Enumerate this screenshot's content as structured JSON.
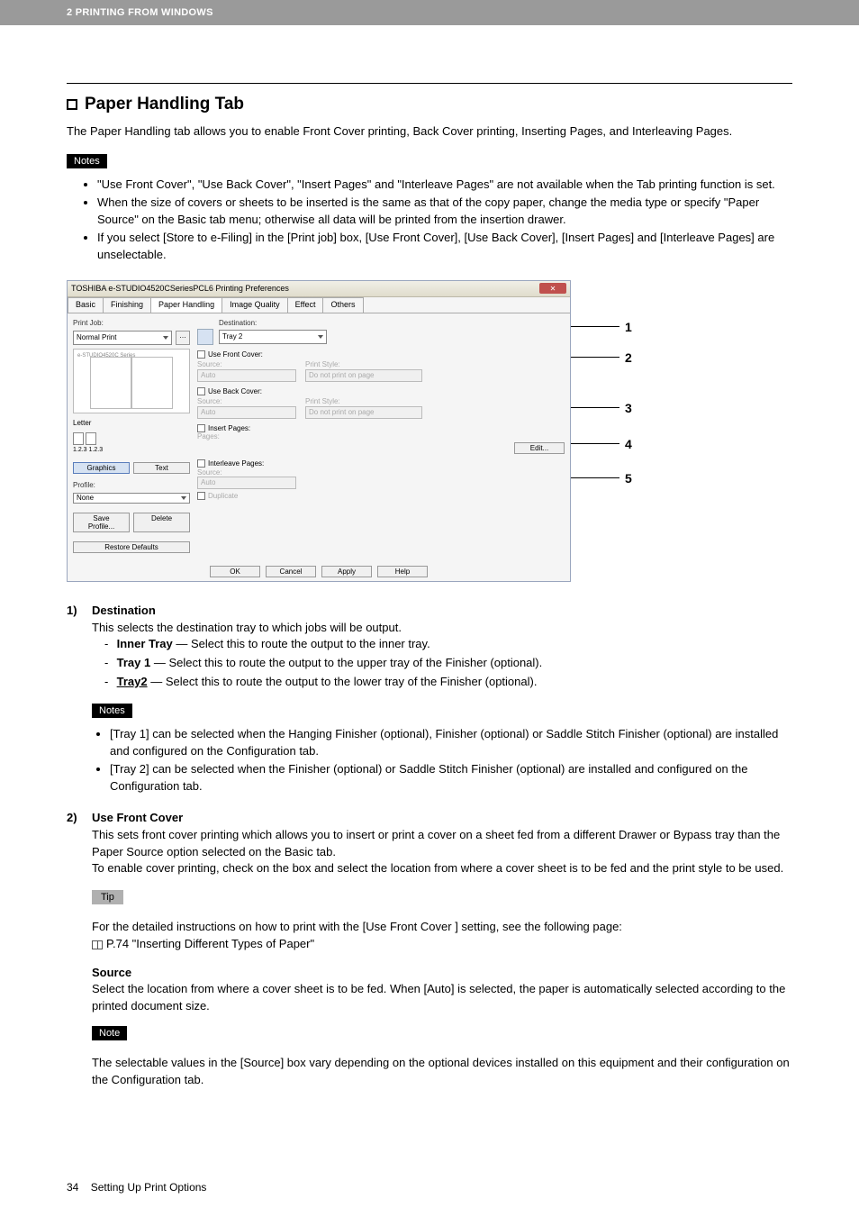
{
  "header": "2 PRINTING FROM WINDOWS",
  "section": {
    "title": "Paper Handling Tab",
    "intro": "The Paper Handling tab allows you to enable Front Cover printing, Back Cover printing, Inserting Pages, and Interleaving Pages."
  },
  "notes1": {
    "label": "Notes",
    "items": [
      "\"Use Front Cover\", \"Use Back Cover\", \"Insert Pages\" and \"Interleave Pages\" are not available when the Tab printing function is set.",
      "When the size of covers or sheets to be inserted is the same as that of the copy paper, change the media type or specify \"Paper Source\" on the Basic tab menu; otherwise all data will be printed from the insertion drawer.",
      "If you select [Store to e-Filing] in the [Print job] box, [Use Front Cover], [Use Back Cover], [Insert Pages] and [Interleave Pages] are unselectable."
    ]
  },
  "dialog": {
    "title": "TOSHIBA e-STUDIO4520CSeriesPCL6 Printing Preferences",
    "tabs": [
      "Basic",
      "Finishing",
      "Paper Handling",
      "Image Quality",
      "Effect",
      "Others"
    ],
    "active_tab": "Paper Handling",
    "print_job_label": "Print Job:",
    "print_job_value": "Normal Print",
    "paper": "Letter",
    "paper_sub": "1.2.3   1.2.3",
    "btn_graphics": "Graphics",
    "btn_text": "Text",
    "profile_label": "Profile:",
    "profile_value": "None",
    "save_profile": "Save Profile...",
    "delete": "Delete",
    "restore": "Restore Defaults",
    "dest_label": "Destination:",
    "dest_value": "Tray 2",
    "groups": {
      "front": {
        "title": "Use Front Cover:",
        "src": "Source:",
        "src_v": "Auto",
        "ps": "Print Style:",
        "ps_v": "Do not print on page"
      },
      "back": {
        "title": "Use Back Cover:",
        "src": "Source:",
        "src_v": "Auto",
        "ps": "Print Style:",
        "ps_v": "Do not print on page"
      },
      "insert": {
        "title": "Insert Pages:",
        "pages": "Pages:",
        "edit": "Edit..."
      },
      "inter": {
        "title": "Interleave Pages:",
        "src": "Source:",
        "src_v": "Auto",
        "dup": "Duplicate"
      }
    },
    "footer": {
      "ok": "OK",
      "cancel": "Cancel",
      "apply": "Apply",
      "help": "Help"
    }
  },
  "callouts": [
    "1",
    "2",
    "3",
    "4",
    "5"
  ],
  "items": {
    "i1": {
      "num": "1)",
      "term": "Destination",
      "desc": "This selects the destination tray to which jobs will be output.",
      "opts": {
        "inner": {
          "name": "Inner Tray",
          "rest": " — Select this to route the output to the inner tray."
        },
        "t1": {
          "name": "Tray 1",
          "rest": " — Select this to route the output to the upper tray of the Finisher (optional)."
        },
        "t2": {
          "name": "Tray2",
          "rest": " — Select this to route the output to the lower tray of the Finisher (optional)."
        }
      }
    },
    "i2": {
      "num": "2)",
      "term": "Use Front Cover",
      "p1": "This sets front cover printing which allows you to insert or print a cover on a sheet fed from a different Drawer or Bypass tray than the Paper Source option selected on the Basic tab.",
      "p2": "To enable cover printing, check on the box and select the location from where a cover sheet is to be fed and the print style to be used."
    }
  },
  "notes2": {
    "label": "Notes",
    "items": [
      "[Tray 1] can be selected when the Hanging Finisher (optional), Finisher (optional) or Saddle Stitch Finisher (optional) are installed and configured on the Configuration tab.",
      "[Tray 2] can be selected when the Finisher (optional) or Saddle Stitch Finisher (optional) are installed and configured on the Configuration tab."
    ]
  },
  "tip": {
    "label": "Tip",
    "line1": "For the detailed instructions on how to print with the [Use Front Cover ] setting, see the following page:",
    "line2": "P.74 \"Inserting Different Types of Paper\""
  },
  "source": {
    "h": "Source",
    "p": "Select the location from where a cover sheet is to be fed.  When [Auto] is selected, the paper is automatically selected according to the printed document size."
  },
  "note3": {
    "label": "Note",
    "p": "The selectable values in the [Source] box vary depending on the optional devices installed on this equipment and their configuration on the Configuration tab."
  },
  "footer": {
    "page": "34",
    "title": "Setting Up Print Options"
  }
}
